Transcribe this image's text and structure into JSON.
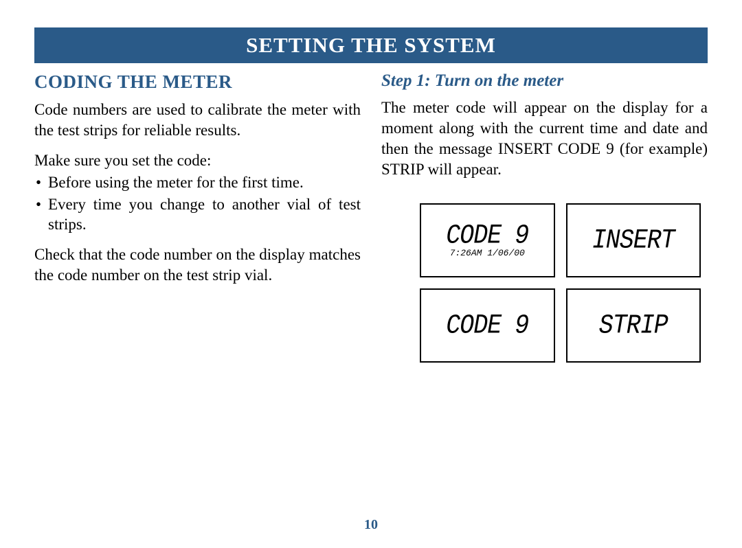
{
  "header": {
    "title": "SETTING THE SYSTEM"
  },
  "left_column": {
    "heading": "CODING THE METER",
    "intro": "Code numbers are used to calibrate the meter with the test strips for reliable results.",
    "instruction_lead": "Make sure you set the code:",
    "bullets": [
      "Before using the meter for the first time.",
      "Every time you change to another vial of test strips."
    ],
    "check_note": "Check that the code number on the display matches the code number on the test strip vial."
  },
  "right_column": {
    "step_heading": "Step 1: Turn on the meter",
    "step_body": "The meter code will appear on the display for a moment along with the current time and date and then the message INSERT CODE 9 (for example) STRIP will appear.",
    "lcd_screens": [
      {
        "main": "CODE 9",
        "sub": "7:26AM 1/06/00"
      },
      {
        "main": "INSERT",
        "sub": ""
      },
      {
        "main": "CODE 9",
        "sub": ""
      },
      {
        "main": "STRIP",
        "sub": ""
      }
    ]
  },
  "page_number": "10"
}
